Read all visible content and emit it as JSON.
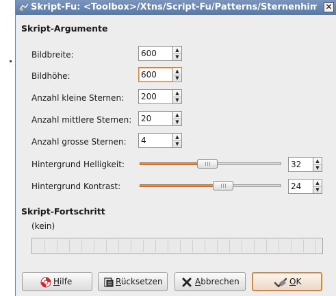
{
  "window": {
    "title": "Skript-Fu: <Toolbox>/Xtns/Script-Fu/Patterns/Sternenhimmel",
    "close_glyph": "✕"
  },
  "args_section": {
    "title": "Skript-Argumente",
    "fields": [
      {
        "label": "Bildbreite:",
        "value": "600"
      },
      {
        "label": "Bildhöhe:",
        "value": "600"
      },
      {
        "label": "Anzahl kleine Sternen:",
        "value": "200"
      },
      {
        "label": "Anzahl mittlere Sternen:",
        "value": "20"
      },
      {
        "label": "Anzahl grosse Sternen:",
        "value": "4"
      }
    ],
    "sliders": [
      {
        "label": "Hintergrund Helligkeit:",
        "value": "32",
        "fraction": 0.48
      },
      {
        "label": "Hintergrund Kontrast:",
        "value": "24",
        "fraction": 0.59
      }
    ]
  },
  "progress_section": {
    "title": "Skript-Fortschritt",
    "status": "(kein)",
    "progress": 0
  },
  "buttons": {
    "help": {
      "pre": "",
      "mnemonic": "H",
      "post": "ilfe"
    },
    "reset": {
      "pre": "",
      "mnemonic": "R",
      "post": "ücksetzen"
    },
    "cancel": {
      "pre": "",
      "mnemonic": "A",
      "post": "bbrechen"
    },
    "ok": {
      "pre": "",
      "mnemonic": "O",
      "post": "K"
    }
  },
  "colors": {
    "accent": "#d8843e",
    "titlebar": "#6786b2"
  },
  "icons": [
    "app-icon",
    "help-lifebuoy-icon",
    "reset-icon",
    "cancel-x-icon",
    "ok-check-icon"
  ]
}
